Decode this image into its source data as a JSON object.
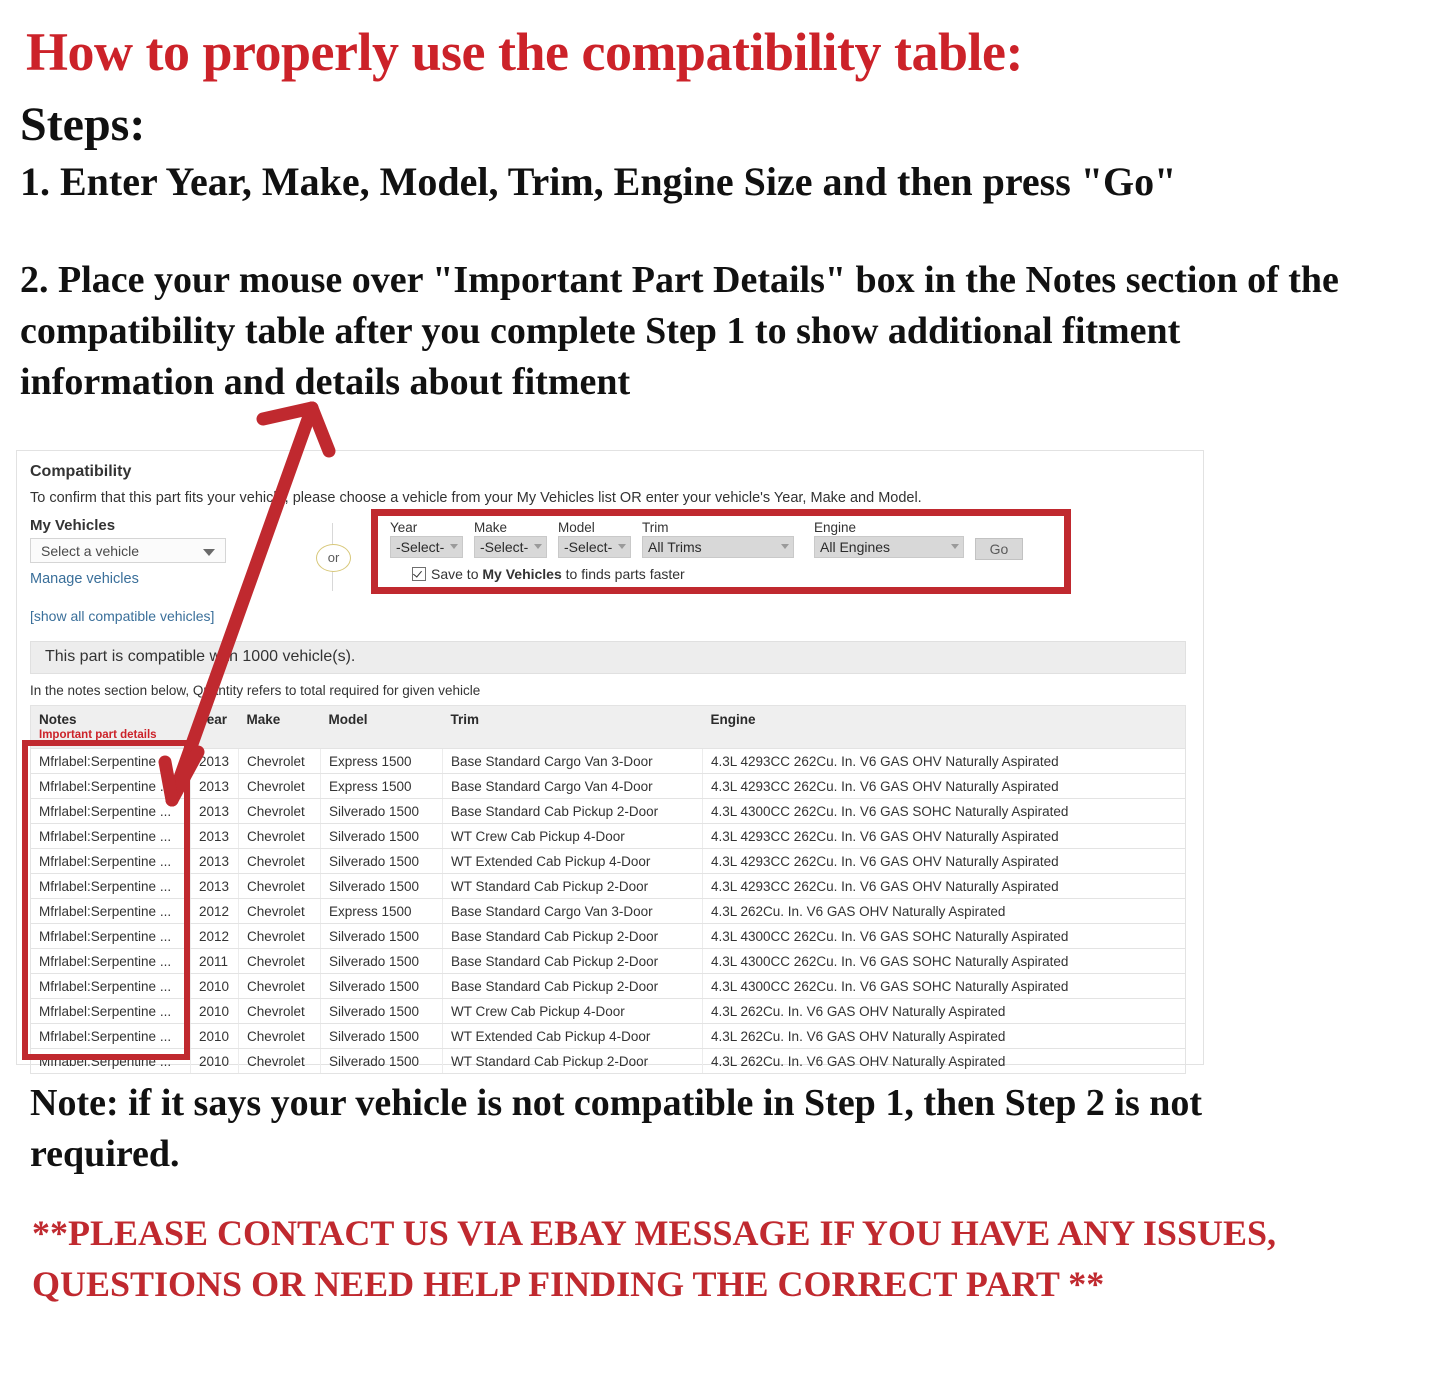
{
  "headline": {
    "title": "How to properly use the compatibility table:",
    "steps_label": "Steps:",
    "step1": "1. Enter Year, Make, Model, Trim, Engine Size and then press \"Go\"",
    "step2": "2. Place your mouse over \"Important Part Details\" box in the Notes section of the compatibility table after you complete Step 1 to show additional fitment information and details about fitment",
    "note": "Note: if it says your vehicle is not compatible in Step 1, then Step 2 is not required.",
    "contact": "**PLEASE CONTACT US VIA EBAY MESSAGE IF YOU HAVE ANY ISSUES, QUESTIONS OR NEED HELP FINDING THE CORRECT PART **"
  },
  "colors": {
    "red_headline": "#CC2229",
    "red_callout": "#C0292F",
    "link_blue": "#3a6f9a",
    "header_gray": "#efefef"
  },
  "compatibility": {
    "title": "Compatibility",
    "subtitle": "To confirm that this part fits your vehicle, please choose a vehicle from your My Vehicles list OR enter your vehicle's Year, Make and Model.",
    "my_vehicles_label": "My Vehicles",
    "vehicle_select_value": "Select a vehicle",
    "manage_vehicles_link": "Manage vehicles",
    "show_all_link": "[show all compatible vehicles]",
    "or_divider": "or",
    "banner_text": "This part is compatible with 1000 vehicle(s).",
    "quantity_note": "In the notes section below, Quantity refers to total required for given vehicle",
    "form": {
      "fields": [
        {
          "label": "Year",
          "value": "-Select-"
        },
        {
          "label": "Make",
          "value": "-Select-"
        },
        {
          "label": "Model",
          "value": "-Select-"
        },
        {
          "label": "Trim",
          "value": "All Trims"
        },
        {
          "label": "Engine",
          "value": "All Engines"
        }
      ],
      "go_label": "Go",
      "save_prefix": "Save to ",
      "save_bold": "My Vehicles",
      "save_suffix": " to finds parts faster",
      "save_checked": true
    }
  },
  "table": {
    "headers": {
      "notes": "Notes",
      "notes_sub": "Important part details",
      "year": "Year",
      "make": "Make",
      "model": "Model",
      "trim": "Trim",
      "engine": "Engine"
    },
    "rows": [
      {
        "notes": "Mfrlabel:Serpentine ...",
        "year": "2013",
        "make": "Chevrolet",
        "model": "Express 1500",
        "trim": "Base Standard Cargo Van 3-Door",
        "engine": "4.3L 4293CC 262Cu. In. V6 GAS OHV Naturally Aspirated"
      },
      {
        "notes": "Mfrlabel:Serpentine ...",
        "year": "2013",
        "make": "Chevrolet",
        "model": "Express 1500",
        "trim": "Base Standard Cargo Van 4-Door",
        "engine": "4.3L 4293CC 262Cu. In. V6 GAS OHV Naturally Aspirated"
      },
      {
        "notes": "Mfrlabel:Serpentine ...",
        "year": "2013",
        "make": "Chevrolet",
        "model": "Silverado 1500",
        "trim": "Base Standard Cab Pickup 2-Door",
        "engine": "4.3L 4300CC 262Cu. In. V6 GAS SOHC Naturally Aspirated"
      },
      {
        "notes": "Mfrlabel:Serpentine ...",
        "year": "2013",
        "make": "Chevrolet",
        "model": "Silverado 1500",
        "trim": "WT Crew Cab Pickup 4-Door",
        "engine": "4.3L 4293CC 262Cu. In. V6 GAS OHV Naturally Aspirated"
      },
      {
        "notes": "Mfrlabel:Serpentine ...",
        "year": "2013",
        "make": "Chevrolet",
        "model": "Silverado 1500",
        "trim": "WT Extended Cab Pickup 4-Door",
        "engine": "4.3L 4293CC 262Cu. In. V6 GAS OHV Naturally Aspirated"
      },
      {
        "notes": "Mfrlabel:Serpentine ...",
        "year": "2013",
        "make": "Chevrolet",
        "model": "Silverado 1500",
        "trim": "WT Standard Cab Pickup 2-Door",
        "engine": "4.3L 4293CC 262Cu. In. V6 GAS OHV Naturally Aspirated"
      },
      {
        "notes": "Mfrlabel:Serpentine ...",
        "year": "2012",
        "make": "Chevrolet",
        "model": "Express 1500",
        "trim": "Base Standard Cargo Van 3-Door",
        "engine": "4.3L 262Cu. In. V6 GAS OHV Naturally Aspirated"
      },
      {
        "notes": "Mfrlabel:Serpentine ...",
        "year": "2012",
        "make": "Chevrolet",
        "model": "Silverado 1500",
        "trim": "Base Standard Cab Pickup 2-Door",
        "engine": "4.3L 4300CC 262Cu. In. V6 GAS SOHC Naturally Aspirated"
      },
      {
        "notes": "Mfrlabel:Serpentine ...",
        "year": "2011",
        "make": "Chevrolet",
        "model": "Silverado 1500",
        "trim": "Base Standard Cab Pickup 2-Door",
        "engine": "4.3L 4300CC 262Cu. In. V6 GAS SOHC Naturally Aspirated"
      },
      {
        "notes": "Mfrlabel:Serpentine ...",
        "year": "2010",
        "make": "Chevrolet",
        "model": "Silverado 1500",
        "trim": "Base Standard Cab Pickup 2-Door",
        "engine": "4.3L 4300CC 262Cu. In. V6 GAS SOHC Naturally Aspirated"
      },
      {
        "notes": "Mfrlabel:Serpentine ...",
        "year": "2010",
        "make": "Chevrolet",
        "model": "Silverado 1500",
        "trim": "WT Crew Cab Pickup 4-Door",
        "engine": "4.3L 262Cu. In. V6 GAS OHV Naturally Aspirated"
      },
      {
        "notes": "Mfrlabel:Serpentine ...",
        "year": "2010",
        "make": "Chevrolet",
        "model": "Silverado 1500",
        "trim": "WT Extended Cab Pickup 4-Door",
        "engine": "4.3L 262Cu. In. V6 GAS OHV Naturally Aspirated"
      },
      {
        "notes": "Mfrlabel:Serpentine ...",
        "year": "2010",
        "make": "Chevrolet",
        "model": "Silverado 1500",
        "trim": "WT Standard Cab Pickup 2-Door",
        "engine": "4.3L 262Cu. In. V6 GAS OHV Naturally Aspirated"
      }
    ]
  }
}
